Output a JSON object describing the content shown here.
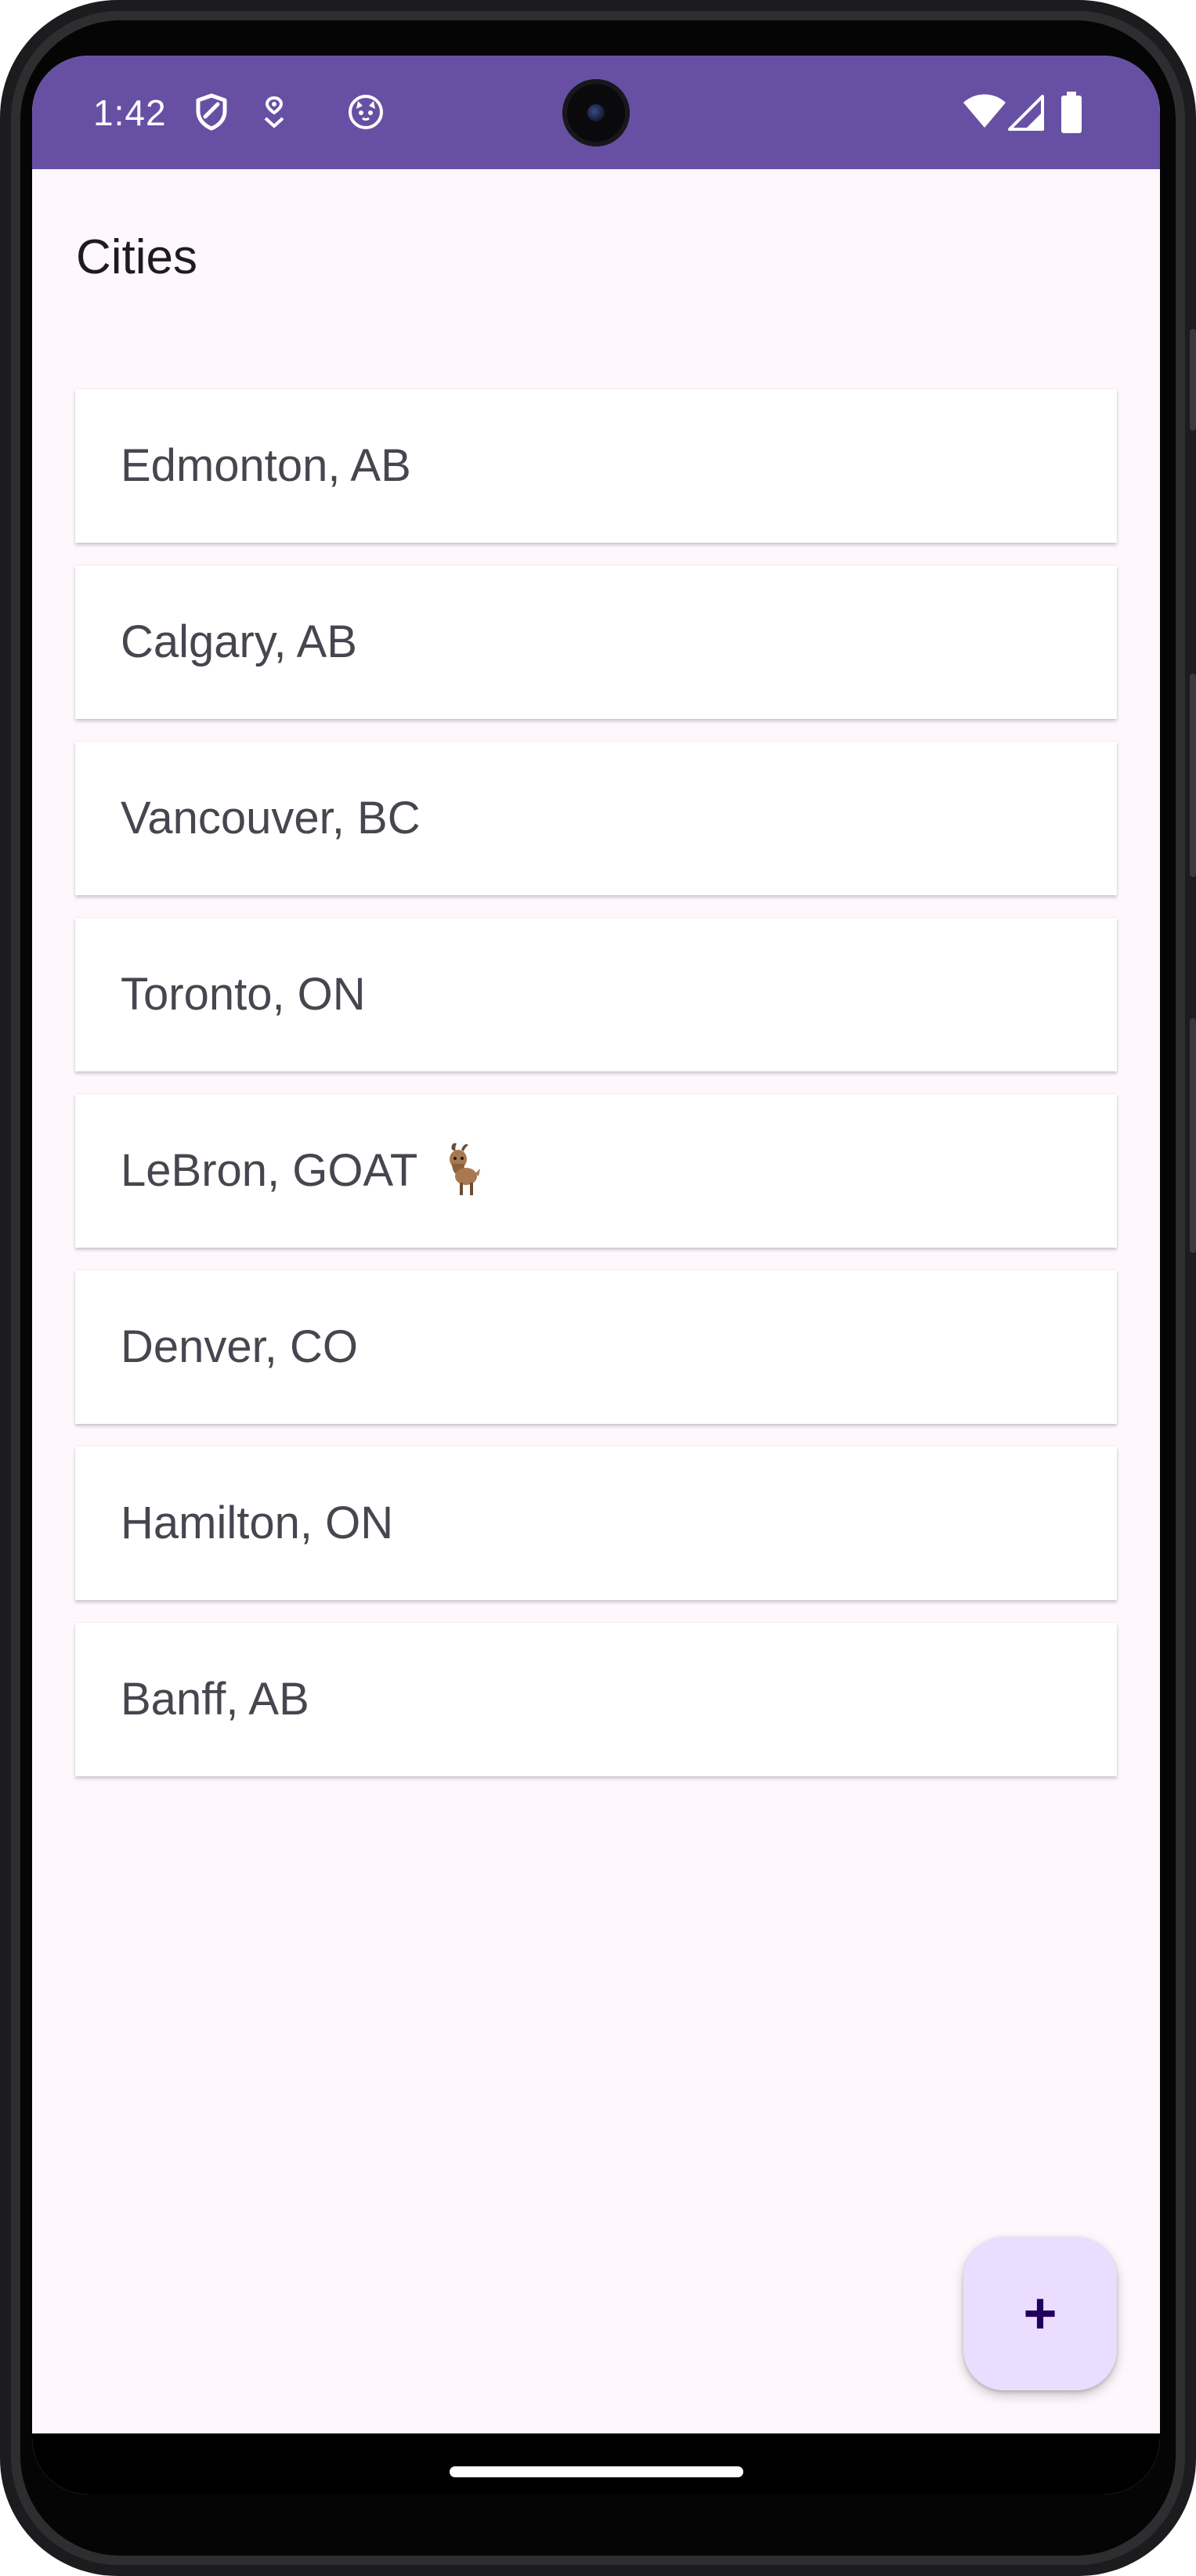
{
  "status_bar": {
    "time": "1:42",
    "background_color": "#6750a4",
    "left_icons": [
      "shield-icon",
      "location-dot-icon",
      "cat-face-icon"
    ],
    "right_icons": [
      "wifi-icon",
      "signal-icon",
      "battery-icon"
    ]
  },
  "app": {
    "title": "Cities",
    "background_color": "#fef7fc",
    "card_color": "#ffffff",
    "text_color": "#49454f"
  },
  "cities": [
    {
      "label": "Edmonton, AB"
    },
    {
      "label": "Calgary, AB"
    },
    {
      "label": "Vancouver, BC"
    },
    {
      "label": "Toronto, ON"
    },
    {
      "label": "LeBron, GOAT",
      "icon": "goat-icon"
    },
    {
      "label": "Denver, CO"
    },
    {
      "label": "Hamilton, ON"
    },
    {
      "label": "Banff, AB"
    }
  ],
  "fab": {
    "symbol": "+",
    "icon": "plus-icon",
    "background_color": "#eaddff",
    "foreground_color": "#21005d"
  },
  "navigation": {
    "handle": "gesture-home-handle"
  }
}
